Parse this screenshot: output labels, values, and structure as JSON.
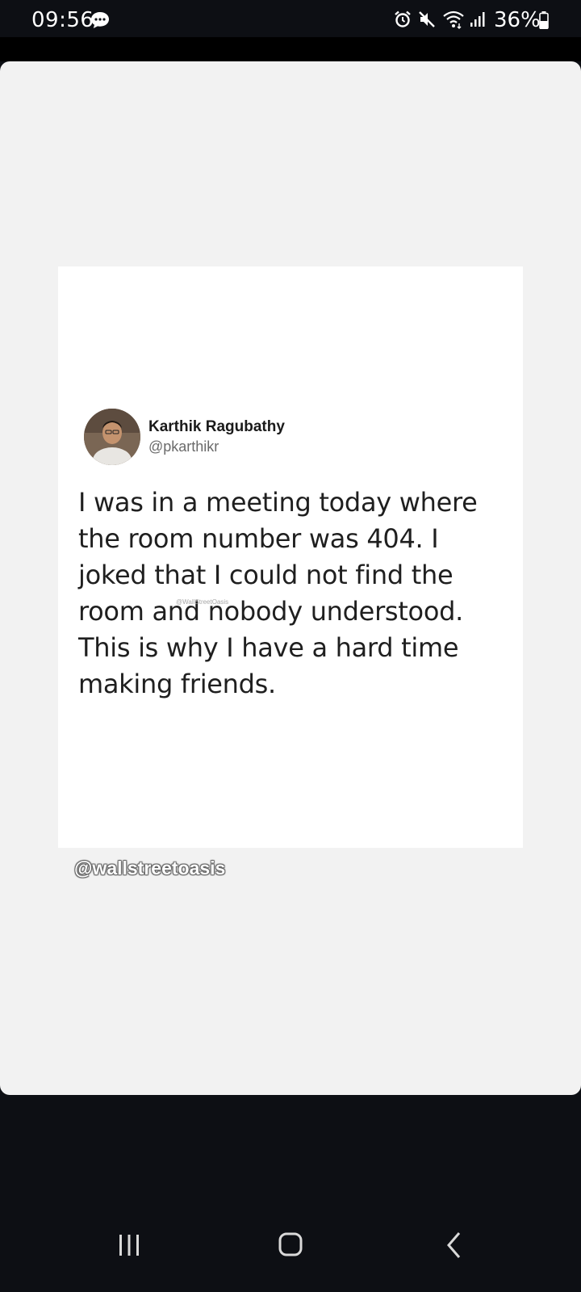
{
  "status_bar": {
    "time": "09:56",
    "battery_percent": "36%",
    "icons": [
      "message-icon",
      "alarm-icon",
      "mute-icon",
      "wifi-icon",
      "signal-icon",
      "battery-icon"
    ]
  },
  "post": {
    "author_name": "Karthik Ragubathy",
    "author_handle": "@pkarthikr",
    "text": "I was in a meeting today where the room number was 404. I joked that I could not find the room and nobody understood. This is why I have a hard time making friends.",
    "image_watermark": "@WallStreetOasis"
  },
  "credit": "@wallstreetoasis",
  "nav_bar": {
    "buttons": [
      "recents-icon",
      "home-icon",
      "back-icon"
    ]
  },
  "colors": {
    "system_bar": "#0d0f14",
    "viewer_background": "#f2f2f2",
    "post_background": "#ffffff"
  }
}
